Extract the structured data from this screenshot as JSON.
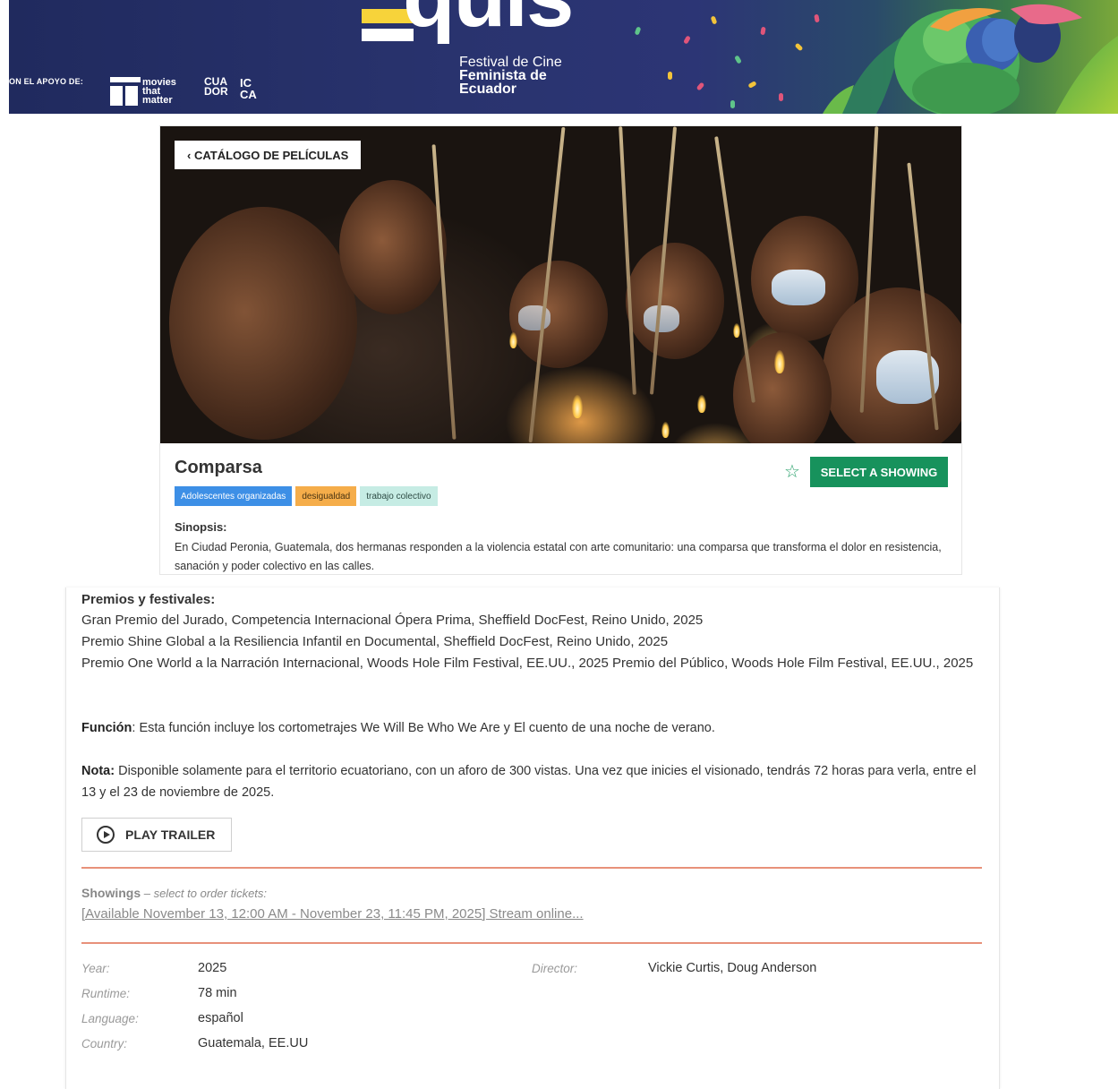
{
  "banner": {
    "supporters_label": "ON EL APOYO DE:",
    "mtm_logo_text": "movies\nthat\nmatter",
    "cuador_logo_text": "CUA\nDOR",
    "icca_logo_text": "IC\nCA",
    "festival_word": "quis",
    "festival_sub_1": "Festival de Cine",
    "festival_sub_2": "Feminista de",
    "festival_sub_3": "Ecuador"
  },
  "hero": {
    "back_label": "‹ CATÁLOGO DE PELÍCULAS"
  },
  "movie": {
    "title": "Comparsa",
    "tags": [
      {
        "label": "Adolescentes organizadas",
        "bg": "#3d8fe6",
        "color": "#ffffff"
      },
      {
        "label": "desigualdad",
        "bg": "#f5ad4a",
        "color": "#4a3412"
      },
      {
        "label": "trabajo colectivo",
        "bg": "#c6ece4",
        "color": "#2f4d46"
      }
    ],
    "select_showing_label": "SELECT A SHOWING",
    "synopsis_label": "Sinopsis:",
    "synopsis_text": "En Ciudad Peronia, Guatemala, dos hermanas responden a la violencia estatal con arte comunitario: una comparsa que transforma el dolor en resistencia, sanación y poder colectivo en las calles."
  },
  "details": {
    "awards_label": "Premios y festivales:",
    "awards": [
      "Gran Premio del Jurado, Competencia Internacional Ópera Prima, Sheffield DocFest, Reino Unido, 2025",
      "Premio Shine Global a la Resiliencia Infantil en Documental, Sheffield DocFest, Reino Unido, 2025",
      "Premio One World a la Narración Internacional, Woods Hole Film Festival, EE.UU., 2025 Premio del Público, Woods Hole Film Festival, EE.UU., 2025"
    ],
    "funcion_label": "Función",
    "funcion_text": ": Esta función incluye los cortometrajes We Will Be Who We Are y El cuento de una noche de verano.",
    "nota_label": "Nota:",
    "nota_text": " Disponible solamente para el territorio ecuatoriano, con un aforo de 300 vistas. Una vez que inicies el visionado, tendrás 72 horas para verla, entre el 13 y el 23 de noviembre de 2025.",
    "trailer_label": "PLAY TRAILER",
    "showings_label": "Showings",
    "showings_hint": " – select to order tickets:",
    "showing_link": "[Available November 13, 12:00 AM - November 23, 11:45 PM, 2025] Stream online...",
    "year_label": "Year:",
    "year_value": "2025",
    "runtime_label": "Runtime:",
    "runtime_value": "78 min",
    "language_label": "Language:",
    "language_value": "español",
    "country_label": "Country:",
    "country_value": "Guatemala, EE.UU",
    "director_label": "Director:",
    "director_value": "Vickie Curtis, Doug Anderson"
  },
  "colors": {
    "banner_navy": "#29336e",
    "accent_green": "#17925c",
    "divider_orange": "#e8917a"
  }
}
